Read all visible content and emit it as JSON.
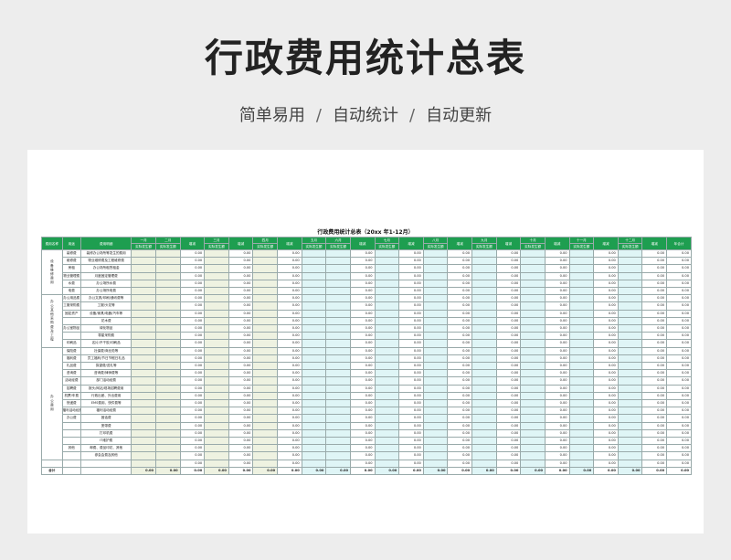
{
  "page": {
    "title": "行政费用统计总表",
    "subtitle_parts": [
      "简单易用",
      "自动统计",
      "自动更新"
    ],
    "separator": "/"
  },
  "sheet": {
    "title": "行政费用统计总表（20xx  年1-12月）",
    "header_row1": [
      "费用名称",
      "用途",
      "费用明细",
      "一月",
      "二月",
      "增减",
      "三月",
      "增减",
      "四月",
      "增减",
      "五月",
      "六月",
      "增减",
      "七月",
      "增减",
      "八月",
      "增减",
      "九月",
      "增减",
      "十月",
      "增减",
      "十一月",
      "增减",
      "十二月",
      "增减",
      "年合计"
    ],
    "header_sub": "实际发生额",
    "zero": "0.00",
    "categories": [
      {
        "name": "设备维修费用",
        "span": 6
      },
      {
        "name": "办公其他采购费及工程",
        "span": 7
      },
      {
        "name": "办公费用",
        "span": 15
      },
      {
        "name": "",
        "span": 1
      }
    ],
    "rows": [
      {
        "usage": "装修费",
        "detail": "装修办公场所等发生的费用"
      },
      {
        "usage": "维修费",
        "detail": "物业维修费及工程维修费"
      },
      {
        "usage": "房租",
        "detail": "办公场所租赁租金"
      },
      {
        "usage": "物业管理费",
        "detail": "月度固定管理费"
      },
      {
        "usage": "水费",
        "detail": "办公场所水费"
      },
      {
        "usage": "电费",
        "detail": "办公场所电费"
      },
      {
        "usage": "办公用品费",
        "detail": "办公文具/印刷/通讯费等"
      },
      {
        "usage": "工服采购费",
        "detail": "工服/头花等"
      },
      {
        "usage": "固定资产",
        "detail": "设备/家具/电器/汽车等"
      },
      {
        "usage": "",
        "detail": "花木费"
      },
      {
        "usage": "办公室物品",
        "detail": "绿化物品"
      },
      {
        "usage": "",
        "detail": "零星采购费"
      },
      {
        "usage": "印刷品",
        "detail": "名片/不干胶/印刷品"
      },
      {
        "usage": "保险费",
        "detail": "社保费/商业险等"
      },
      {
        "usage": "福利费",
        "detail": "员工福利/节日节假日礼品"
      },
      {
        "usage": "礼品费",
        "detail": "探望费/送礼等"
      },
      {
        "usage": "咨询费",
        "detail": "咨询费/律师费等"
      },
      {
        "usage": "活动经费",
        "detail": "部门活动经费"
      },
      {
        "usage": "招聘费",
        "detail": "报头/网站/现场招聘费用"
      },
      {
        "usage": "机票/车费",
        "detail": "行政出差、外出费用"
      },
      {
        "usage": "快递费",
        "detail": "EMS费用、快件费等"
      },
      {
        "usage": "福利活动经费",
        "detail": "福利活动经费"
      },
      {
        "usage": "办公费",
        "detail": "固话费"
      },
      {
        "usage": "",
        "detail": "宽带费"
      },
      {
        "usage": "",
        "detail": "打印机费"
      },
      {
        "usage": "",
        "detail": "IT维护费"
      },
      {
        "usage": "其他",
        "detail": "邮费、费品印花、其他"
      },
      {
        "usage": "",
        "detail": "参会会费及其他"
      },
      {
        "usage": "",
        "detail": ""
      }
    ],
    "total_label": "合计"
  }
}
